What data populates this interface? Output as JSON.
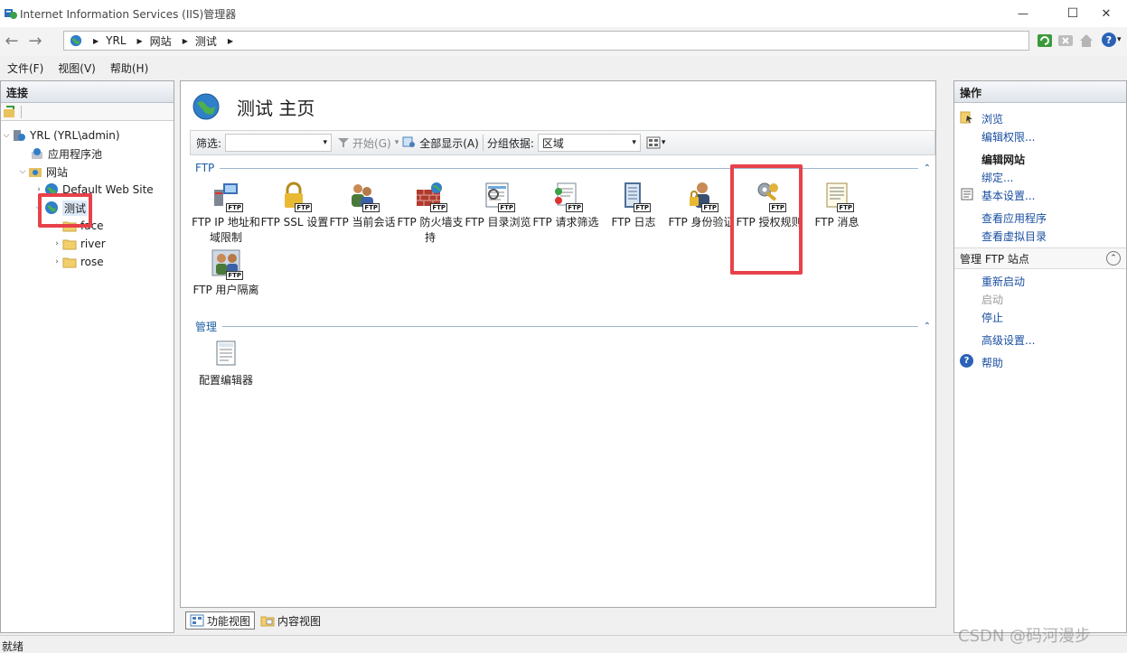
{
  "window": {
    "title": "Internet Information Services (IIS)管理器",
    "min_glyph": "—",
    "max_glyph": "☐",
    "close_glyph": "✕"
  },
  "navigation": {
    "back_glyph": "←",
    "forward_glyph": "→",
    "breadcrumb": [
      "YRL",
      "网站",
      "测试"
    ],
    "separator_glyph": "▶",
    "help_glyph": "?",
    "help_dropdown_glyph": "▾"
  },
  "menu": {
    "items": [
      "文件(F)",
      "视图(V)",
      "帮助(H)"
    ]
  },
  "connections": {
    "title": "连接",
    "tree": [
      {
        "label": "YRL (YRL\\admin)",
        "twisty": "⌵",
        "icon": "server-icon"
      },
      {
        "label": "应用程序池",
        "twisty": "",
        "icon": "app-pool-icon"
      },
      {
        "label": "网站",
        "twisty": "⌵",
        "icon": "sites-folder-icon"
      },
      {
        "label": "Default Web Site",
        "twisty": "›",
        "icon": "globe-icon"
      },
      {
        "label": "测试",
        "twisty": "⌵",
        "icon": "globe-icon",
        "selected": true
      },
      {
        "label": "face",
        "twisty": "›",
        "icon": "folder-icon"
      },
      {
        "label": "river",
        "twisty": "›",
        "icon": "folder-icon"
      },
      {
        "label": "rose",
        "twisty": "›",
        "icon": "folder-icon"
      }
    ]
  },
  "center": {
    "title": "测试 主页",
    "filter": {
      "label": "筛选:",
      "value": "",
      "start_label": "开始(G)",
      "show_all_label": "全部显示(A)",
      "group_by_label": "分组依据:",
      "group_by_value": "区域",
      "dropdown_glyph": "▾"
    },
    "groups": [
      {
        "name": "FTP",
        "collapse_glyph": "⌃",
        "features": [
          {
            "label": "FTP IP 地址和域限制",
            "icon": "ftp-ip-restriction-icon"
          },
          {
            "label": "FTP SSL 设置",
            "icon": "ftp-ssl-lock-icon"
          },
          {
            "label": "FTP 当前会话",
            "icon": "ftp-sessions-icon"
          },
          {
            "label": "FTP 防火墙支持",
            "icon": "ftp-firewall-icon"
          },
          {
            "label": "FTP 目录浏览",
            "icon": "ftp-directory-icon"
          },
          {
            "label": "FTP 请求筛选",
            "icon": "ftp-request-filter-icon"
          },
          {
            "label": "FTP 日志",
            "icon": "ftp-log-icon"
          },
          {
            "label": "FTP 身份验证",
            "icon": "ftp-auth-icon"
          },
          {
            "label": "FTP 授权规则",
            "icon": "ftp-authorization-key-icon",
            "highlighted": true
          },
          {
            "label": "FTP 消息",
            "icon": "ftp-message-icon"
          },
          {
            "label": "FTP 用户隔离",
            "icon": "ftp-user-isolation-icon"
          }
        ]
      },
      {
        "name": "管理",
        "collapse_glyph": "⌃",
        "features": [
          {
            "label": "配置编辑器",
            "icon": "config-editor-icon"
          }
        ]
      }
    ],
    "ftp_badge": "FTP",
    "views": [
      "功能视图",
      "内容视图"
    ]
  },
  "actions": {
    "title": "操作",
    "items_top": [
      {
        "label": "浏览",
        "icon": "browse-icon"
      },
      {
        "label": "编辑权限...",
        "icon": ""
      }
    ],
    "edit_site_header": "编辑网站",
    "items_site": [
      {
        "label": "绑定...",
        "icon": ""
      },
      {
        "label": "基本设置...",
        "icon": "basic-settings-icon"
      },
      {
        "label": "查看应用程序",
        "icon": ""
      },
      {
        "label": "查看虚拟目录",
        "icon": ""
      }
    ],
    "ftp_section": {
      "title": "管理 FTP 站点",
      "collapse_glyph": "⌃",
      "items": [
        {
          "label": "重新启动",
          "disabled": false
        },
        {
          "label": "启动",
          "disabled": true
        },
        {
          "label": "停止",
          "disabled": false
        }
      ]
    },
    "advanced_label": "高级设置...",
    "help_label": "帮助"
  },
  "status": {
    "text": "就绪"
  },
  "watermark": "CSDN @码河漫步",
  "colors": {
    "accent": "#1a4fa0",
    "highlight_box": "#e8414a"
  }
}
